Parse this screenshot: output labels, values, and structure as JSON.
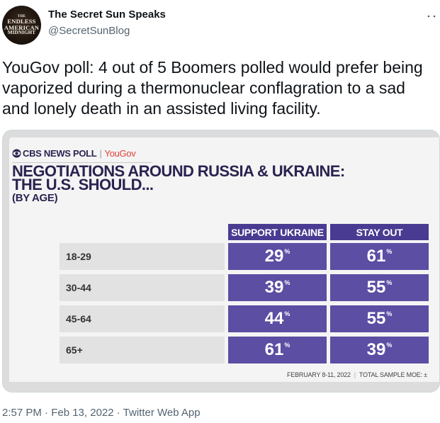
{
  "tweet": {
    "display_name": "The Secret Sun Speaks",
    "handle": "@SecretSunBlog",
    "avatar_text": [
      "THE",
      "ENDLESS",
      "AMERICAN",
      "MIDNIGHT"
    ],
    "text": "YouGov poll: 4 out of 5 Boomers polled would prefer being vaporized during a thermonuclear conflagration to a sad and lonely death in an assisted living facility.",
    "timestamp": "2:57 PM · Feb 13, 2022 · Twitter Web App",
    "more_icon": "more-horizontal-icon"
  },
  "media": {
    "brand": "CBS NEWS POLL",
    "brand_partner": "YouGov",
    "brand_icon": "cbs-eye-icon",
    "title_line1": "NEGOTIATIONS AROUND RUSSIA & UKRAINE:",
    "title_line2": "THE U.S. SHOULD...",
    "subtitle": "(BY AGE)",
    "columns": [
      "SUPPORT UKRAINE",
      "STAY OUT"
    ],
    "rows": [
      {
        "label": "18-29",
        "support": "29",
        "stay": "61"
      },
      {
        "label": "30-44",
        "support": "39",
        "stay": "55"
      },
      {
        "label": "45-64",
        "support": "44",
        "stay": "55"
      },
      {
        "label": "65+",
        "support": "61",
        "stay": "39"
      }
    ],
    "pct_symbol": "%",
    "footer_date": "FEBRUARY 8-11, 2022",
    "footer_moe": "TOTAL SAMPLE MOE: ±",
    "colors": {
      "header": "#4a3b92",
      "cell": "#5b4ea3",
      "title": "#2a2350",
      "partner": "#e0413b"
    }
  }
}
